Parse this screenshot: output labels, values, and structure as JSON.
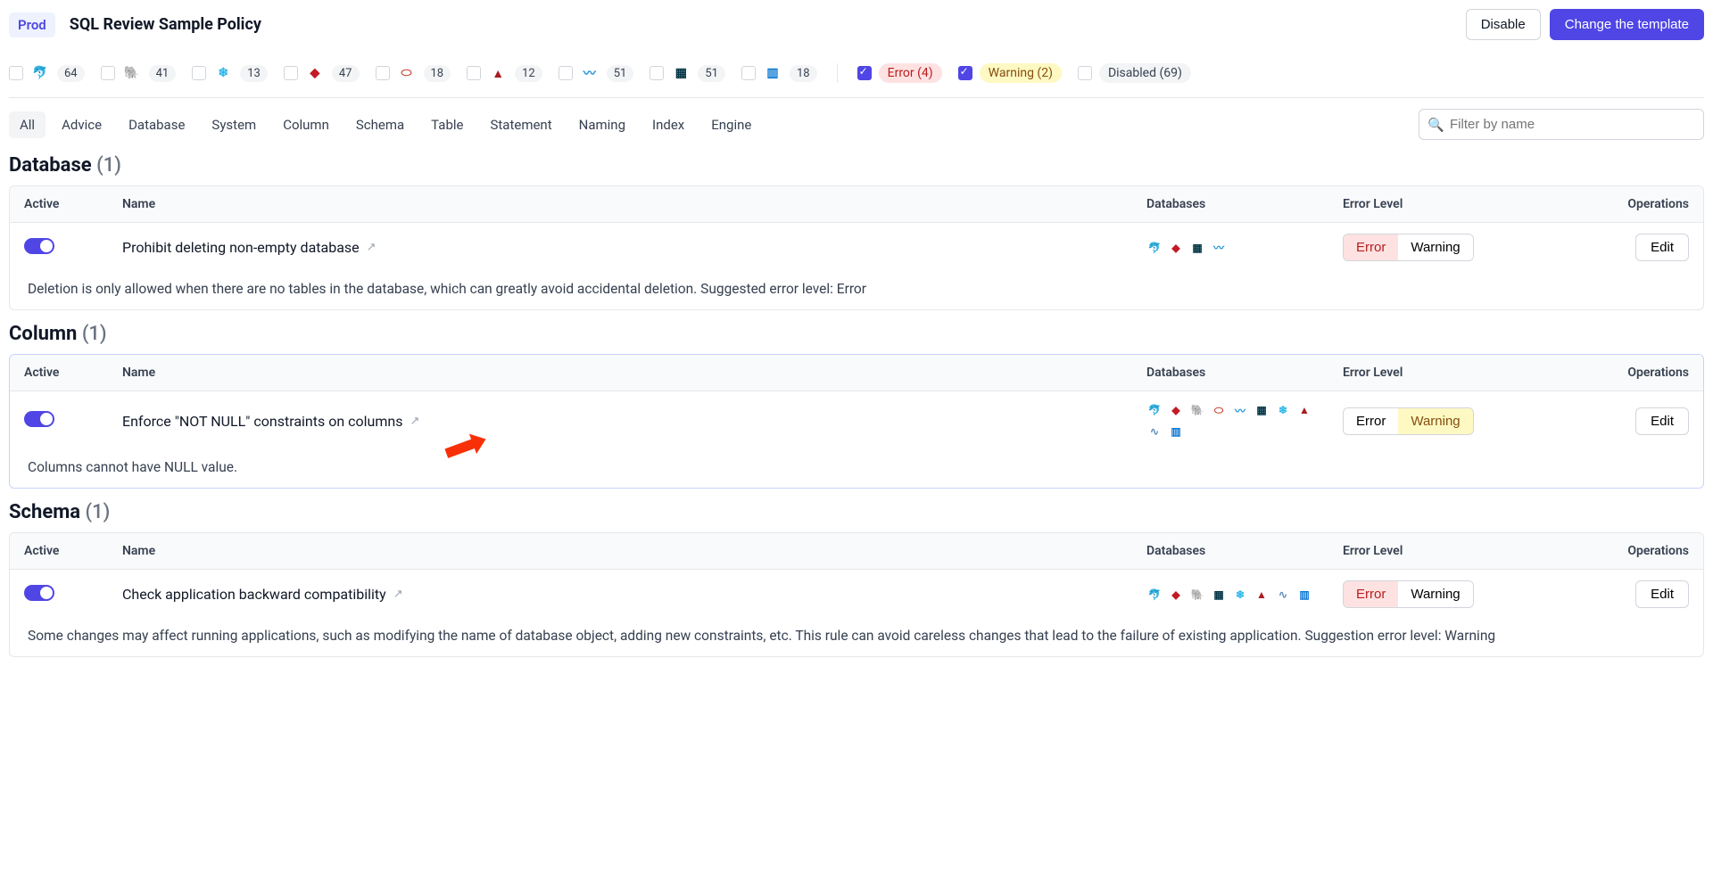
{
  "header": {
    "env": "Prod",
    "title": "SQL Review Sample Policy",
    "disable": "Disable",
    "change": "Change the template"
  },
  "filters": {
    "db": [
      {
        "icon": "mysql",
        "count": "64"
      },
      {
        "icon": "pg",
        "count": "41"
      },
      {
        "icon": "snow",
        "count": "13"
      },
      {
        "icon": "tidb",
        "count": "47"
      },
      {
        "icon": "oracle",
        "count": "18"
      },
      {
        "icon": "mssql",
        "count": "12"
      },
      {
        "icon": "ocean",
        "count": "51"
      },
      {
        "icon": "maria",
        "count": "51"
      },
      {
        "icon": "dm",
        "count": "18"
      }
    ],
    "status": {
      "error_label": "Error (4)",
      "warning_label": "Warning (2)",
      "disabled_label": "Disabled (69)"
    }
  },
  "tabs": [
    "All",
    "Advice",
    "Database",
    "System",
    "Column",
    "Schema",
    "Table",
    "Statement",
    "Naming",
    "Index",
    "Engine"
  ],
  "search_placeholder": "Filter by name",
  "columns": {
    "active": "Active",
    "name": "Name",
    "databases": "Databases",
    "error": "Error Level",
    "ops": "Operations"
  },
  "levels": {
    "error": "Error",
    "warning": "Warning"
  },
  "edit_label": "Edit",
  "sections": [
    {
      "title": "Database",
      "count": "(1)",
      "rule_name": "Prohibit deleting non-empty database",
      "dbs": [
        "mysql",
        "tidb",
        "maria",
        "ocean"
      ],
      "selected": "error",
      "desc": "Deletion is only allowed when there are no tables in the database, which can greatly avoid accidental deletion. Suggested error level: Error"
    },
    {
      "title": "Column",
      "count": "(1)",
      "rule_name": "Enforce \"NOT NULL\" constraints on columns",
      "dbs": [
        "mysql",
        "tidb",
        "pg",
        "oracle",
        "ocean",
        "maria",
        "snow",
        "mssql",
        "risingwave",
        "dm"
      ],
      "selected": "warning",
      "desc": "Columns cannot have NULL value.",
      "highlight": true
    },
    {
      "title": "Schema",
      "count": "(1)",
      "rule_name": "Check application backward compatibility",
      "dbs": [
        "mysql",
        "tidb",
        "pg",
        "maria",
        "snow",
        "mssql",
        "risingwave",
        "dm"
      ],
      "selected": "error",
      "desc": "Some changes may affect running applications, such as modifying the name of database object, adding new constraints, etc. This rule can avoid careless changes that lead to the failure of existing application. Suggestion error level: Warning"
    }
  ]
}
